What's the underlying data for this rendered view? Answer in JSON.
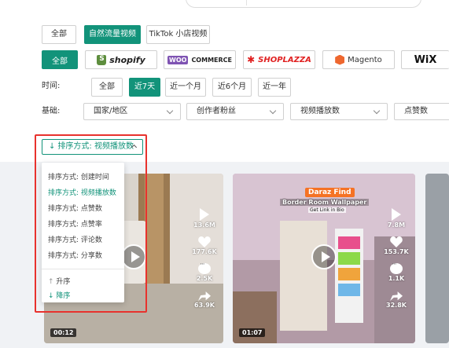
{
  "content_filters": [
    {
      "label": "全部",
      "active": false
    },
    {
      "label": "自然流量视频",
      "active": true
    },
    {
      "label": "TikTok 小店视频",
      "active": false
    }
  ],
  "platforms": [
    {
      "label": "全部",
      "active": true
    },
    {
      "label": "shopify",
      "icon": "shopify-logo-icon"
    },
    {
      "label": "COMMERCE",
      "badge": "WOO",
      "icon": "woocommerce-logo-icon"
    },
    {
      "label": "SHOPLAZZA",
      "icon": "shoplazza-logo-icon"
    },
    {
      "label": "Magento",
      "icon": "magento-logo-icon"
    },
    {
      "label": "WiX",
      "icon": "wix-logo-icon"
    }
  ],
  "time": {
    "label": "时间:",
    "options": [
      {
        "label": "全部",
        "active": false
      },
      {
        "label": "近7天",
        "active": true
      },
      {
        "label": "近一个月",
        "active": false
      },
      {
        "label": "近6个月",
        "active": false
      },
      {
        "label": "近一年",
        "active": false
      }
    ]
  },
  "basic": {
    "label": "基础:",
    "selects": [
      "国家/地区",
      "创作者粉丝",
      "视频播放数",
      "点赞数"
    ]
  },
  "sort": {
    "label": "排序方式: 视频播放数",
    "options": [
      {
        "label": "排序方式: 创建时间",
        "active": false
      },
      {
        "label": "排序方式: 视频播放数",
        "active": true
      },
      {
        "label": "排序方式: 点赞数",
        "active": false
      },
      {
        "label": "排序方式: 点赞率",
        "active": false
      },
      {
        "label": "排序方式: 评论数",
        "active": false
      },
      {
        "label": "排序方式: 分享数",
        "active": false
      }
    ],
    "order": [
      {
        "label": "升序",
        "active": false
      },
      {
        "label": "降序",
        "active": true
      }
    ]
  },
  "videos": [
    {
      "plays": "13.6M",
      "likes": "177.6K",
      "comments": "2.5K",
      "shares": "63.9K",
      "duration": "00:12"
    },
    {
      "plays": "7.8M",
      "likes": "153.7K",
      "comments": "1.1K",
      "shares": "32.8K",
      "duration": "01:07",
      "overlay_title": "Daraz Find",
      "overlay_subtitle": "Border Room Wallpaper",
      "overlay_cta": "Get Link in Bio"
    }
  ],
  "colors": {
    "accent": "#12937a",
    "highlight": "#e8322d",
    "content_bg": "#f0f2f5"
  }
}
